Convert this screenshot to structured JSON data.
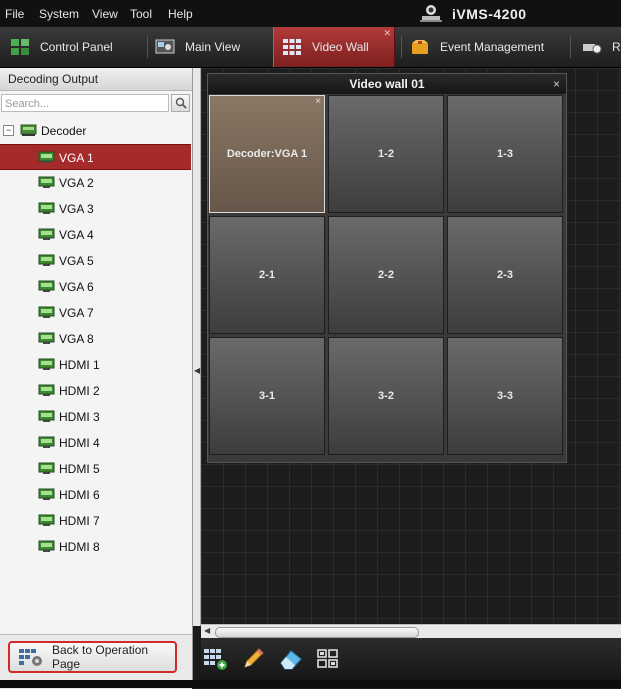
{
  "menu": {
    "items": [
      "File",
      "System",
      "View",
      "Tool",
      "Help"
    ]
  },
  "app": {
    "title": "iVMS-4200"
  },
  "tabs": [
    {
      "label": "Control Panel",
      "icon": "control-panel-icon"
    },
    {
      "label": "Main View",
      "icon": "main-view-icon"
    },
    {
      "label": "Video Wall",
      "icon": "video-wall-icon",
      "active": true
    },
    {
      "label": "Event Management",
      "icon": "event-management-icon"
    },
    {
      "label": "R",
      "icon": "remote-icon"
    }
  ],
  "left_panel": {
    "header": "Decoding Output",
    "search_placeholder": "Search...",
    "root_label": "Decoder",
    "items": [
      "VGA 1",
      "VGA 2",
      "VGA 3",
      "VGA 4",
      "VGA 5",
      "VGA 6",
      "VGA 7",
      "VGA 8",
      "HDMI 1",
      "HDMI 2",
      "HDMI 3",
      "HDMI 4",
      "HDMI 5",
      "HDMI 6",
      "HDMI 7",
      "HDMI 8"
    ],
    "selected_item": "VGA 1",
    "back_button": "Back to Operation Page"
  },
  "wall": {
    "title": "Video wall 01",
    "close": "×",
    "cells": [
      "Decoder:VGA 1",
      "1-2",
      "1-3",
      "2-1",
      "2-2",
      "2-3",
      "3-1",
      "3-2",
      "3-3"
    ],
    "active_cell": "Decoder:VGA 1"
  },
  "bottom_tools": [
    "add-window-icon",
    "edit-pencil-icon",
    "eraser-icon",
    "split-screen-icon"
  ],
  "colors": {
    "accent": "#a52a2a",
    "highlight_border": "#d02a2a"
  }
}
